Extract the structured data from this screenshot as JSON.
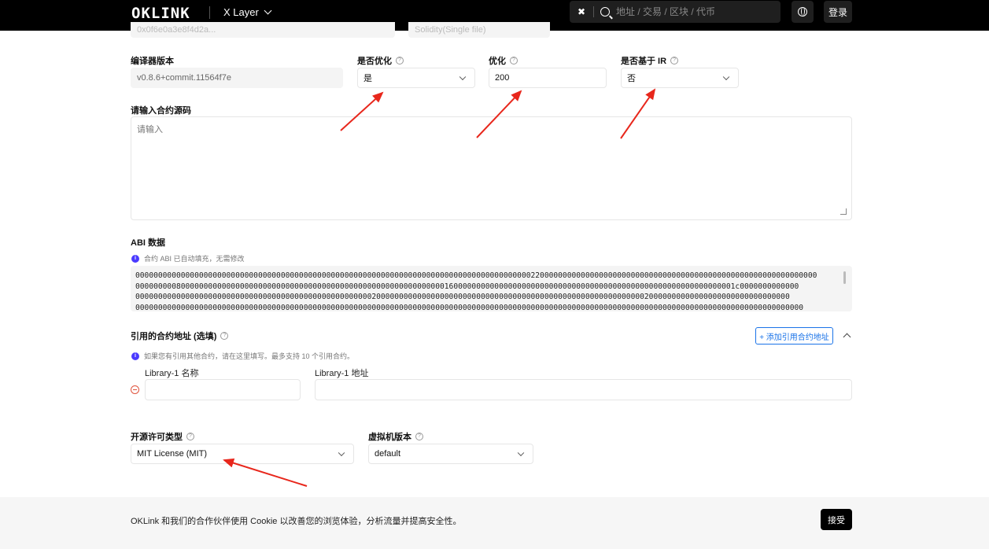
{
  "header": {
    "logo": "OKLINK",
    "chain": "X Layer",
    "search_placeholder": "地址 / 交易 / 区块 / 代币",
    "login": "登录"
  },
  "partial_top": {
    "left_value": "0x0f6e0a3e8f4d2a...",
    "right_value": "Solidity(Single file)"
  },
  "compiler": {
    "version_label": "编译器版本",
    "version_value": "v0.8.6+commit.11564f7e",
    "optimize_label": "是否优化",
    "optimize_value": "是",
    "runs_label": "优化",
    "runs_value": "200",
    "ir_label": "是否基于 IR",
    "ir_value": "否"
  },
  "source": {
    "label": "请输入合约源码",
    "placeholder": "请输入"
  },
  "abi": {
    "label": "ABI 数据",
    "note": "合约 ABI 已自动填充，无需修改",
    "lines": [
      "000000000000000000000000000000000000000000000000000000000000000000000000000000000000000220000000000000000000000000000000000000000000000000000000000000",
      "000000000800000000000000000000000000000000000000000000000000000000001600000000000000000000000000000000000000000000000000000000000001c0000000000000",
      "000000000000000000000000000000000000000000000000000020000000000000000000000000000000000000000000000000000000000020000000000000000000000000000000",
      "000000000000000000000000000000000000000000000000000000000000000000000000000000000000000000000000000000000000000000000000000000000000000000000000000"
    ]
  },
  "libraries": {
    "label": "引用的合约地址 (选填)",
    "add_button": "+ 添加引用合约地址",
    "note": "如果您有引用其他合约，请在这里填写。最多支持 10 个引用合约。",
    "name_label": "Library-1 名称",
    "address_label": "Library-1 地址"
  },
  "license": {
    "label": "开源许可类型",
    "value": "MIT License (MIT)",
    "evm_label": "虚拟机版本",
    "evm_value": "default"
  },
  "cookie": {
    "text": "OKLink 和我们的合作伙伴使用 Cookie 以改善您的浏览体验，分析流量并提高安全性。",
    "accept": "接受"
  },
  "colors": {
    "header_bg": "#000000",
    "arrow": "#e8271c",
    "link_blue": "#1a73e8",
    "info_purple": "#4a3aff"
  }
}
